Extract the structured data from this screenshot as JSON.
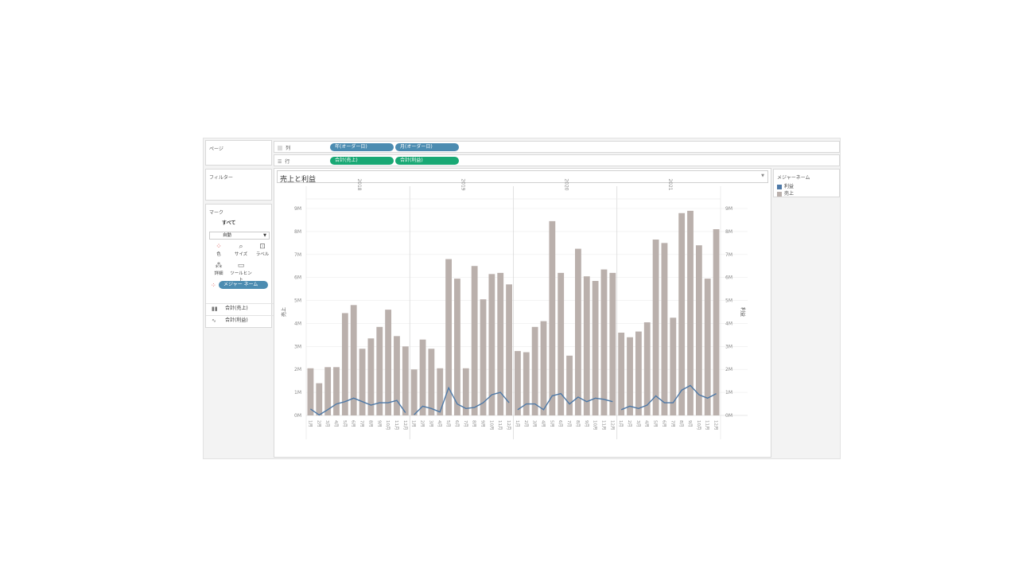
{
  "shelves": {
    "pages_label": "ページ",
    "columns_label": "列",
    "rows_label": "行",
    "column_pills": [
      "年(オーダー日)",
      "月(オーダー日)"
    ],
    "row_pills": [
      "合計(売上)",
      "合計(利益)"
    ]
  },
  "filters": {
    "label": "フィルター"
  },
  "marks": {
    "label": "マーク",
    "all_label": "すべて",
    "mark_type": "自動",
    "buttons": [
      "色",
      "サイズ",
      "ラベル",
      "詳細",
      "ツールヒント"
    ],
    "measure_names_pill": "メジャー ネーム",
    "measures": [
      "合計(売上)",
      "合計(利益)"
    ]
  },
  "legend": {
    "title": "メジャーネーム",
    "items": [
      {
        "label": "利益",
        "color": "#4e79a7"
      },
      {
        "label": "売上",
        "color": "#bab0ac"
      }
    ]
  },
  "view": {
    "title": "売上と利益"
  },
  "chart_data": {
    "type": "bar",
    "years": [
      "2018",
      "2019",
      "2020",
      "2021"
    ],
    "months": [
      "1月",
      "2月",
      "3月",
      "4月",
      "5月",
      "6月",
      "7月",
      "8月",
      "9月",
      "10月",
      "11月",
      "12月"
    ],
    "ylabel_left": "売上",
    "ylabel_right": "利益",
    "y_ticks": [
      "0M",
      "1M",
      "2M",
      "3M",
      "4M",
      "5M",
      "6M",
      "7M",
      "8M",
      "9M"
    ],
    "ylim": [
      0,
      9000000
    ],
    "series": [
      {
        "name": "売上",
        "type": "bar",
        "color": "#bab0ac",
        "values": [
          2050000,
          1400000,
          2100000,
          2100000,
          4450000,
          4800000,
          2900000,
          3350000,
          3850000,
          4600000,
          3450000,
          3000000,
          2000000,
          3300000,
          2900000,
          2050000,
          6800000,
          5950000,
          2050000,
          6500000,
          5050000,
          6150000,
          6200000,
          5700000,
          2800000,
          2750000,
          3850000,
          4100000,
          8450000,
          6200000,
          2600000,
          7250000,
          6050000,
          5850000,
          6350000,
          6200000,
          3600000,
          3400000,
          3650000,
          4050000,
          7650000,
          7500000,
          4250000,
          8800000,
          8900000,
          7400000,
          5950000,
          8100000
        ]
      },
      {
        "name": "利益",
        "type": "line",
        "color": "#4e79a7",
        "values": [
          280000,
          20000,
          250000,
          500000,
          600000,
          750000,
          600000,
          450000,
          550000,
          550000,
          650000,
          120000,
          30000,
          400000,
          300000,
          150000,
          1200000,
          500000,
          300000,
          350000,
          550000,
          900000,
          1000000,
          550000,
          250000,
          500000,
          500000,
          250000,
          850000,
          950000,
          500000,
          800000,
          600000,
          750000,
          700000,
          600000,
          250000,
          400000,
          300000,
          450000,
          850000,
          550000,
          550000,
          1100000,
          1300000,
          900000,
          750000,
          950000
        ]
      }
    ]
  }
}
